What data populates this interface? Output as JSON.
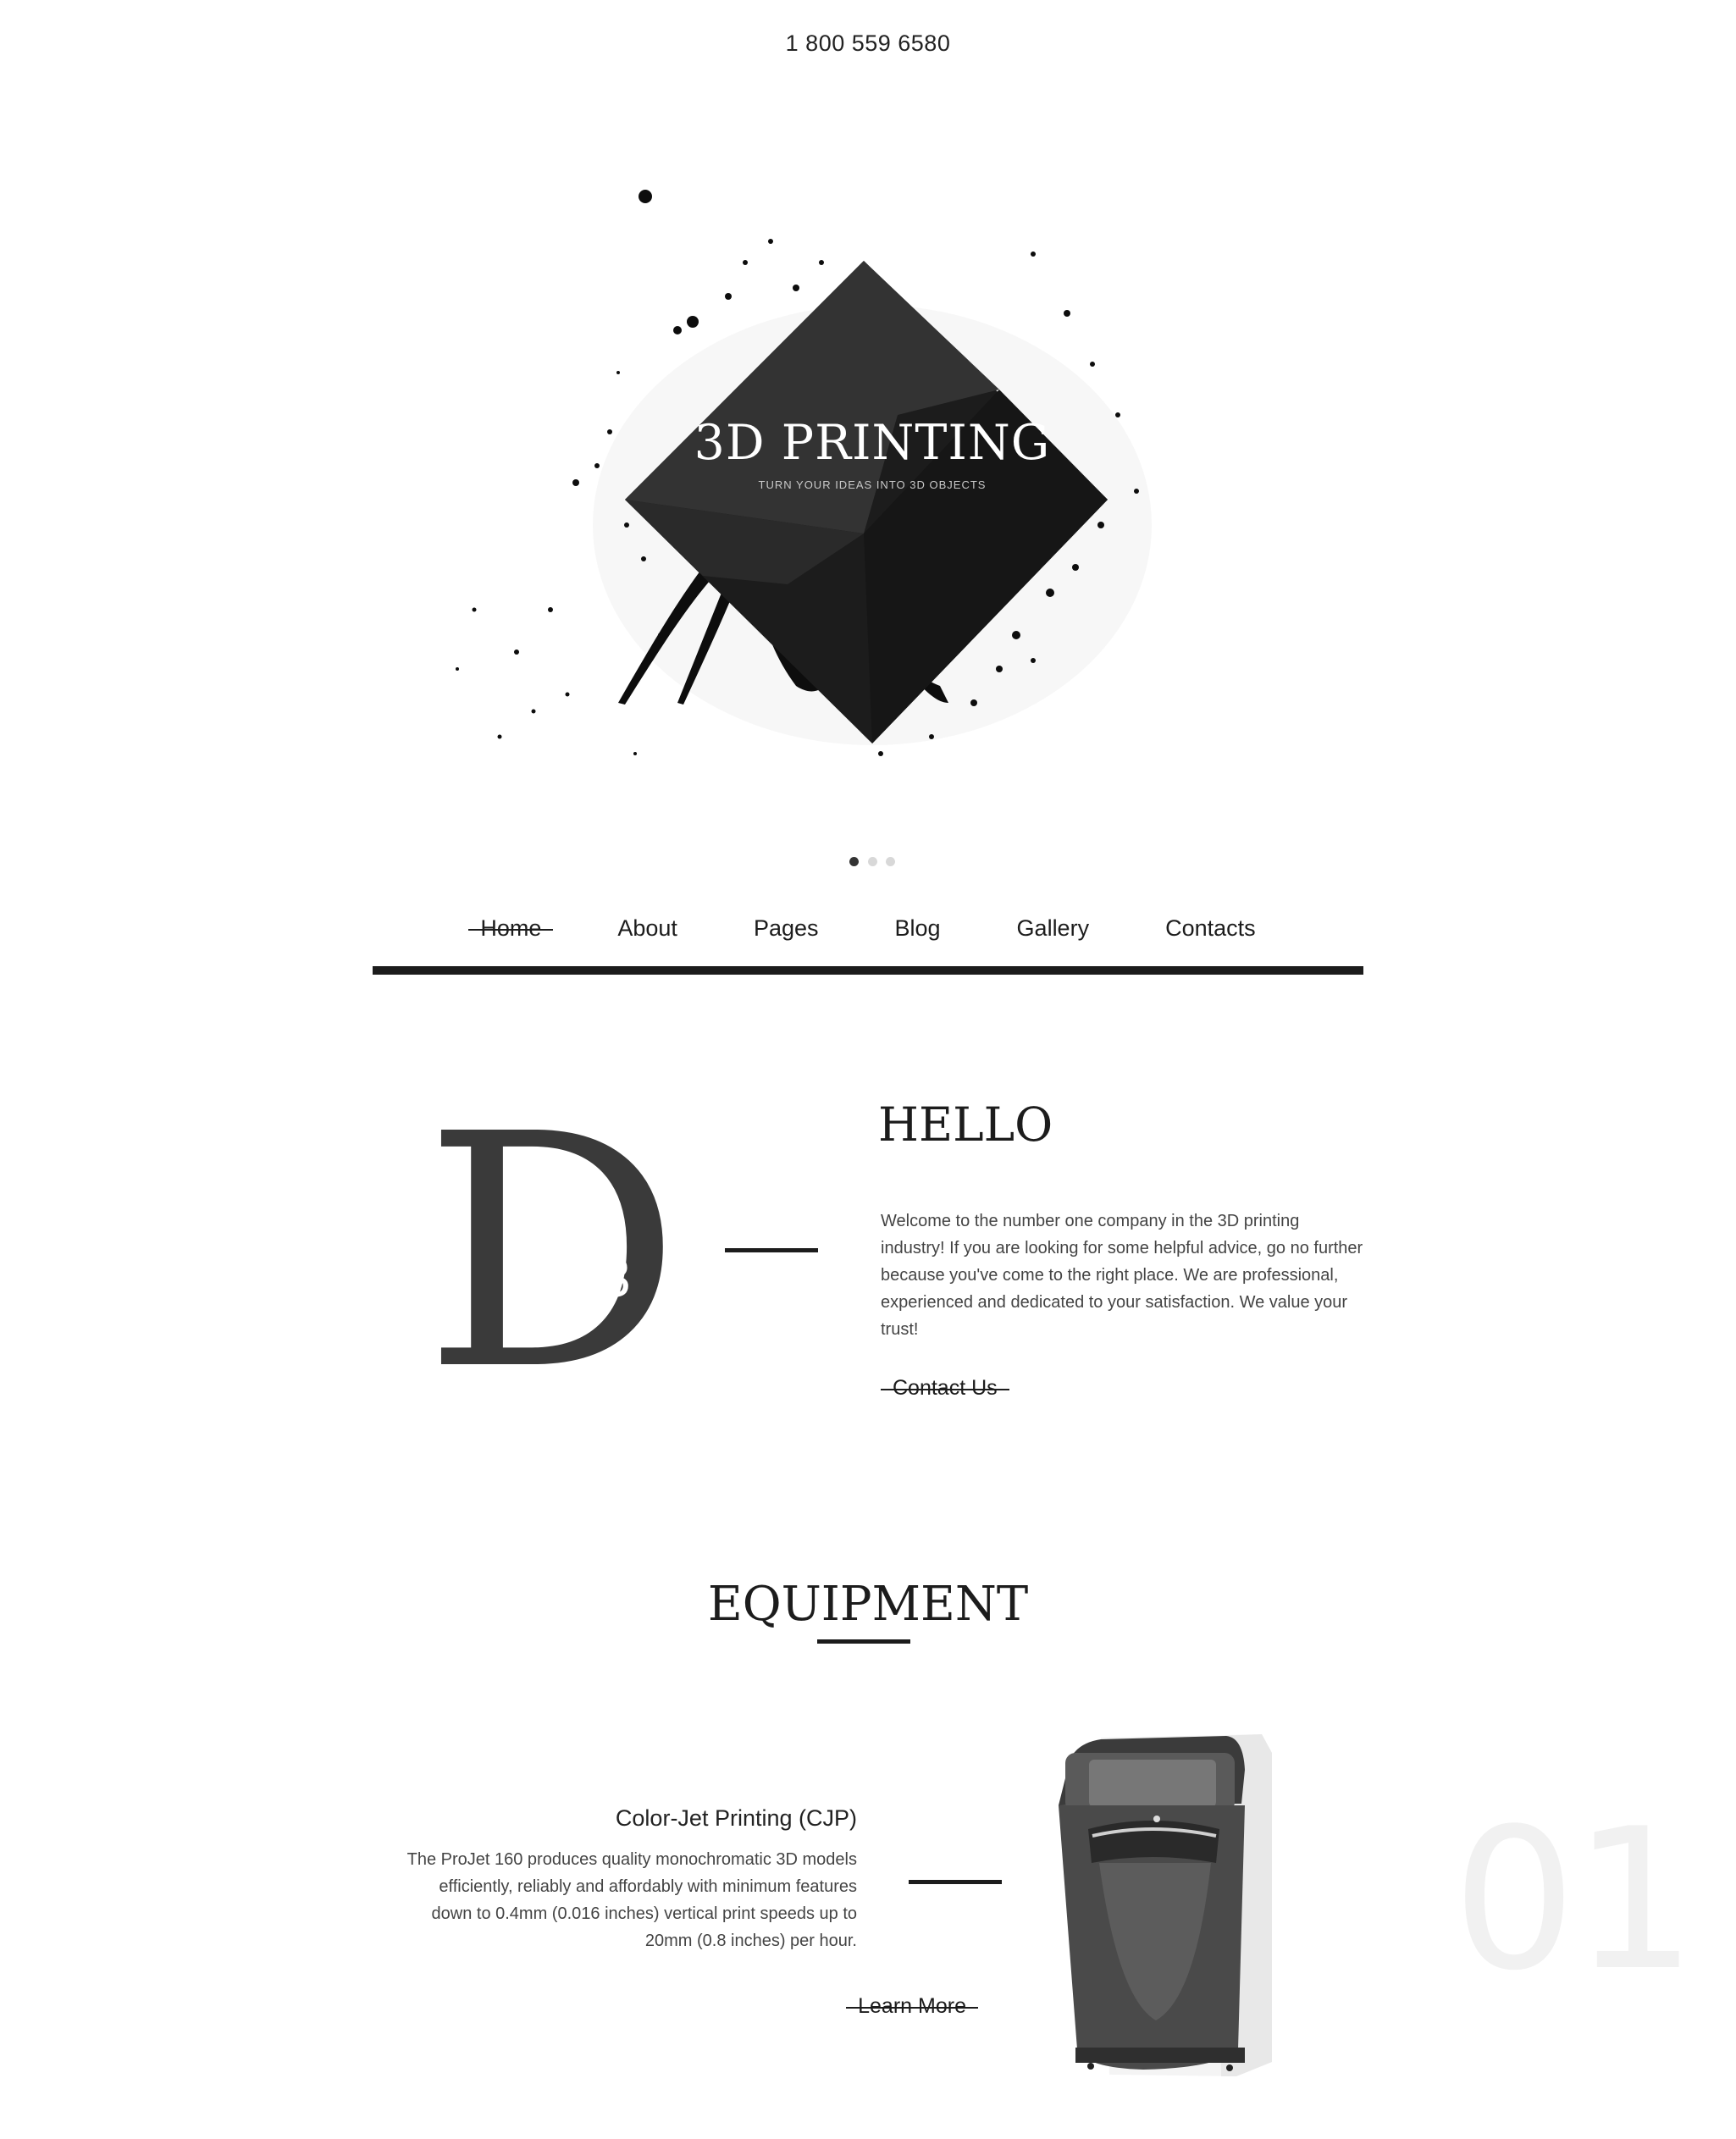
{
  "header": {
    "phone": "1 800 559 6580"
  },
  "hero": {
    "title": "3D PRINTING",
    "subtitle": "TURN YOUR IDEAS INTO 3D OBJECTS",
    "slides_total": 3,
    "slide_active": 1
  },
  "nav": {
    "items": [
      {
        "label": "Home"
      },
      {
        "label": "About"
      },
      {
        "label": "Pages"
      },
      {
        "label": "Blog"
      },
      {
        "label": "Gallery"
      },
      {
        "label": "Contacts"
      }
    ],
    "active": "Home"
  },
  "hello": {
    "logo_letter": "D",
    "logo_sup": "3",
    "title": "HELLO",
    "text": "Welcome to the number one company in the 3D printing industry! If you are looking for some helpful advice, go no further because you've come to the right place. We are professional, experienced and dedicated to your satisfaction. We value your trust!",
    "cta": "Contact Us"
  },
  "equipment": {
    "title": "EQUIPMENT",
    "items": [
      {
        "number": "01",
        "title": "Color-Jet Printing (CJP)",
        "text": "The ProJet 160 produces quality monochromatic 3D models efficiently, reliably and affordably with minimum features down to 0.4mm (0.016 inches) vertical print speeds up to 20mm (0.8 inches) per hour.",
        "cta": "Learn More"
      }
    ]
  },
  "colors": {
    "text": "#1c1c1c",
    "accent_dark": "#2a2a2a",
    "muted_number": "#f1f1f1"
  }
}
